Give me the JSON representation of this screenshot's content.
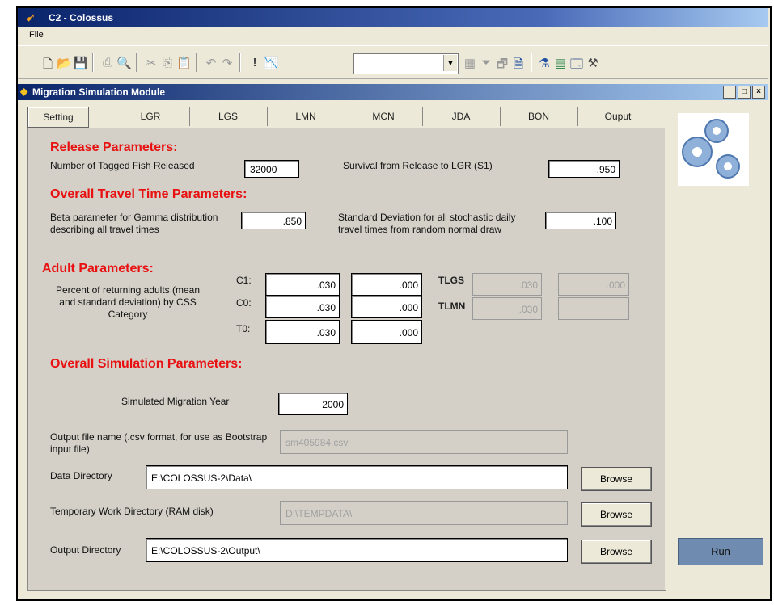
{
  "app": {
    "title": "C2 - Colossus",
    "menu": [
      "File"
    ]
  },
  "toolbar": {
    "combo_value": ""
  },
  "module": {
    "title": "Migration Simulation Module",
    "min": "_",
    "restore": "□",
    "close": "×"
  },
  "tabs": [
    "Setting",
    "LGR",
    "LGS",
    "LMN",
    "MCN",
    "JDA",
    "BON",
    "Ouput"
  ],
  "release": {
    "heading": "Release Parameters:",
    "tagged_label": "Number of Tagged Fish Released",
    "tagged_value": "32000",
    "survival_label": "Survival from Release to LGR (S1)",
    "survival_value": ".950"
  },
  "travel": {
    "heading": "Overall Travel Time Parameters:",
    "beta_label": "Beta parameter for Gamma distribution describing all travel times",
    "beta_value": ".850",
    "sd_label": "Standard Deviation for all stochastic daily travel times from random normal draw",
    "sd_value": ".100"
  },
  "adult": {
    "heading": "Adult Parameters:",
    "desc": "Percent of returning adults (mean and standard deviation) by CSS Category",
    "rows": [
      {
        "label": "C1:",
        "mean": ".030",
        "sd": ".000"
      },
      {
        "label": "C0:",
        "mean": ".030",
        "sd": ".000"
      },
      {
        "label": "T0:",
        "mean": ".030",
        "sd": ".000"
      }
    ],
    "tlgs_label": "TLGS",
    "tlgs_mean": ".030",
    "tlgs_sd": ".000",
    "tlmn_label": "TLMN",
    "tlmn_mean": ".030",
    "tlmn_sd": ""
  },
  "simulation": {
    "heading": "Overall Simulation Parameters:",
    "year_label": "Simulated Migration Year",
    "year_value": "2000",
    "outfile_label": "Output file name (.csv format, for use as Bootstrap input file)",
    "outfile_value": "sm405984.csv",
    "datadir_label": "Data Directory",
    "datadir_value": "E:\\COLOSSUS-2\\Data\\",
    "tempdir_label": "Temporary Work Directory (RAM disk)",
    "tempdir_value": "D:\\TEMPDATA\\",
    "outdir_label": "Output Directory",
    "outdir_value": "E:\\COLOSSUS-2\\Output\\",
    "browse_label": "Browse"
  },
  "run_label": "Run",
  "colors": {
    "heading": "#e81010",
    "run_button": "#6f8bb0",
    "title_gradient": "#0a246a"
  },
  "icons": [
    "colossus-app-icon",
    "new-icon",
    "open-icon",
    "save-icon",
    "print-icon",
    "print-preview-icon",
    "cut-icon",
    "copy-icon",
    "paste-icon",
    "undo-icon",
    "redo-icon",
    "exclaim-icon",
    "chart-icon",
    "gear-settings-icon"
  ]
}
